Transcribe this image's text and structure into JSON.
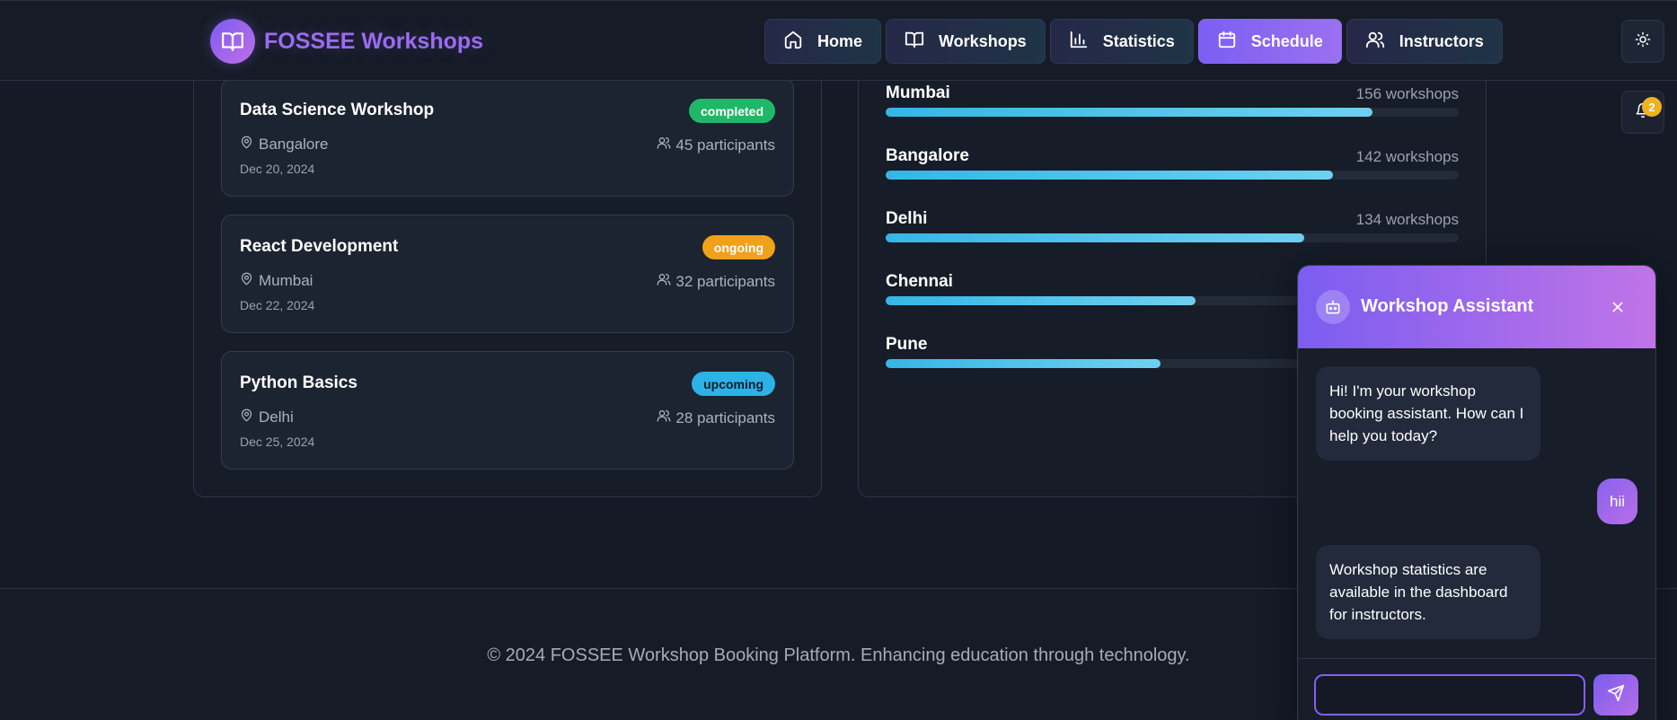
{
  "header": {
    "brand": "FOSSEE Workshops",
    "nav": [
      {
        "label": "Home",
        "icon": "home-icon",
        "active": false
      },
      {
        "label": "Workshops",
        "icon": "book-icon",
        "active": false
      },
      {
        "label": "Statistics",
        "icon": "bar-chart-icon",
        "active": false
      },
      {
        "label": "Schedule",
        "icon": "calendar-icon",
        "active": true
      },
      {
        "label": "Instructors",
        "icon": "users-icon",
        "active": false
      }
    ],
    "notification_count": "2"
  },
  "workshops": [
    {
      "title": "Data Science Workshop",
      "status": "completed",
      "location": "Bangalore",
      "participants": "45 participants",
      "date": "Dec 20, 2024"
    },
    {
      "title": "React Development",
      "status": "ongoing",
      "location": "Mumbai",
      "participants": "32 participants",
      "date": "Dec 22, 2024"
    },
    {
      "title": "Python Basics",
      "status": "upcoming",
      "location": "Delhi",
      "participants": "28 participants",
      "date": "Dec 25, 2024"
    }
  ],
  "cities": [
    {
      "name": "Mumbai",
      "count": "156 workshops",
      "fill_fraction": 0.85
    },
    {
      "name": "Bangalore",
      "count": "142 workshops",
      "fill_fraction": 0.78
    },
    {
      "name": "Delhi",
      "count": "134 workshops",
      "fill_fraction": 0.73
    },
    {
      "name": "Chennai",
      "count": "",
      "fill_fraction": 0.54
    },
    {
      "name": "Pune",
      "count": "",
      "fill_fraction": 0.48
    }
  ],
  "footer": {
    "text": "© 2024 FOSSEE Workshop Booking Platform. Enhancing education through technology."
  },
  "chat": {
    "title": "Workshop Assistant",
    "messages": [
      {
        "from": "bot",
        "text": "Hi! I'm your workshop booking assistant. How can I help you today?"
      },
      {
        "from": "user",
        "text": "hii"
      },
      {
        "from": "bot",
        "text": "Workshop statistics are available in the dashboard for instructors."
      }
    ],
    "input_value": ""
  },
  "colors": {
    "accent": "#8b5cf6",
    "completed": "#1fb868",
    "ongoing": "#f1a01a",
    "upcoming": "#2cb2e6",
    "bar": "#35b6e6"
  }
}
